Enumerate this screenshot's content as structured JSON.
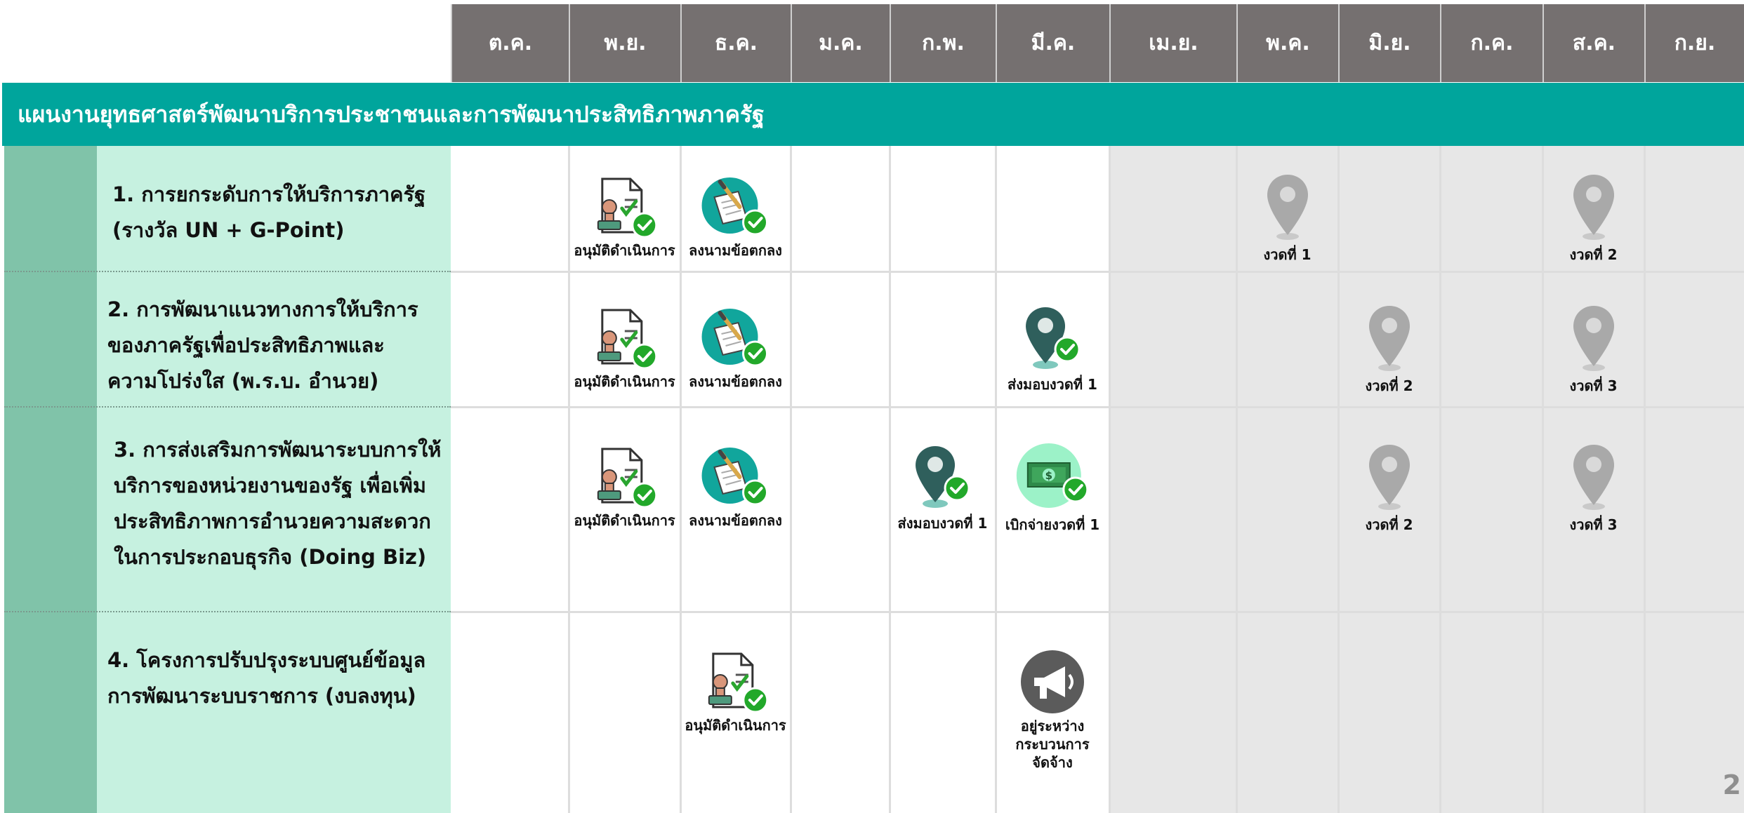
{
  "months": [
    "ต.ค.",
    "พ.ย.",
    "ธ.ค.",
    "ม.ค.",
    "ก.พ.",
    "มี.ค.",
    "เม.ย.",
    "พ.ค.",
    "มิ.ย.",
    "ก.ค.",
    "ส.ค.",
    "ก.ย."
  ],
  "banner_title": "แผนงานยุทธศาสตร์พัฒนาบริการประชาชนและการพัฒนาประสิทธิภาพภาครัฐ",
  "rows": [
    {
      "lines": [
        "1. การยกระดับการให้บริการภาครัฐ",
        "(รางวัล UN + G-Point)"
      ]
    },
    {
      "lines": [
        "2. การพัฒนาแนวทางการให้บริการ",
        "ของภาครัฐเพื่อประสิทธิภาพและ",
        "ความโปร่งใส (พ.ร.บ. อำนวย)"
      ]
    },
    {
      "lines": [
        "3. การส่งเสริมการพัฒนาระบบการให้",
        "บริการของหน่วยงานของรัฐ เพื่อเพิ่ม",
        "ประสิทธิภาพการอำนวยความสะดวก",
        "ในการประกอบธุรกิจ (Doing Biz)"
      ]
    },
    {
      "lines": [
        "4. โครงการปรับปรุงระบบศูนย์ข้อมูล",
        "การพัฒนาระบบราชการ (งบลงทุน)"
      ]
    }
  ],
  "milestones": [
    {
      "row": 1,
      "month": "พ.ย.",
      "icon": "approval-stamp-icon",
      "label": "อนุมัติดำเนินการ"
    },
    {
      "row": 1,
      "month": "ธ.ค.",
      "icon": "signed-agreement-icon",
      "label": "ลงนามข้อตกลง"
    },
    {
      "row": 1,
      "month": "พ.ค.",
      "icon": "location-pin-gray-icon",
      "label": "งวดที่ 1"
    },
    {
      "row": 1,
      "month": "ส.ค.",
      "icon": "location-pin-gray-icon",
      "label": "งวดที่ 2"
    },
    {
      "row": 2,
      "month": "พ.ย.",
      "icon": "approval-stamp-icon",
      "label": "อนุมัติดำเนินการ"
    },
    {
      "row": 2,
      "month": "ธ.ค.",
      "icon": "signed-agreement-icon",
      "label": "ลงนามข้อตกลง"
    },
    {
      "row": 2,
      "month": "มี.ค.",
      "icon": "location-pin-done-icon",
      "label": "ส่งมอบงวดที่ 1"
    },
    {
      "row": 2,
      "month": "มิ.ย.",
      "icon": "location-pin-gray-icon",
      "label": "งวดที่ 2"
    },
    {
      "row": 2,
      "month": "ส.ค.",
      "icon": "location-pin-gray-icon",
      "label": "งวดที่ 3"
    },
    {
      "row": 3,
      "month": "พ.ย.",
      "icon": "approval-stamp-icon",
      "label": "อนุมัติดำเนินการ"
    },
    {
      "row": 3,
      "month": "ธ.ค.",
      "icon": "signed-agreement-icon",
      "label": "ลงนามข้อตกลง"
    },
    {
      "row": 3,
      "month": "ก.พ.",
      "icon": "location-pin-done-icon",
      "label": "ส่งมอบงวดที่ 1"
    },
    {
      "row": 3,
      "month": "มี.ค.",
      "icon": "money-disbursed-icon",
      "label": "เบิกจ่ายงวดที่ 1"
    },
    {
      "row": 3,
      "month": "มิ.ย.",
      "icon": "location-pin-gray-icon",
      "label": "งวดที่ 2"
    },
    {
      "row": 3,
      "month": "ส.ค.",
      "icon": "location-pin-gray-icon",
      "label": "งวดที่ 3"
    },
    {
      "row": 4,
      "month": "ธ.ค.",
      "icon": "approval-stamp-icon",
      "label": "อนุมัติดำเนินการ"
    },
    {
      "row": 4,
      "month": "มี.ค.",
      "icon": "megaphone-icon",
      "label": "อยู่ระหว่างกระบวนการจัดจ้าง"
    }
  ],
  "colors": {
    "header_bg": "#757070",
    "banner_bg": "#00a59c",
    "label_panel_bg": "#c6f1e0",
    "left_strip_bg": "#80c3a9",
    "future_months_bg": "#e7e7e7",
    "check_green": "#22a82a"
  },
  "page_number": "2"
}
